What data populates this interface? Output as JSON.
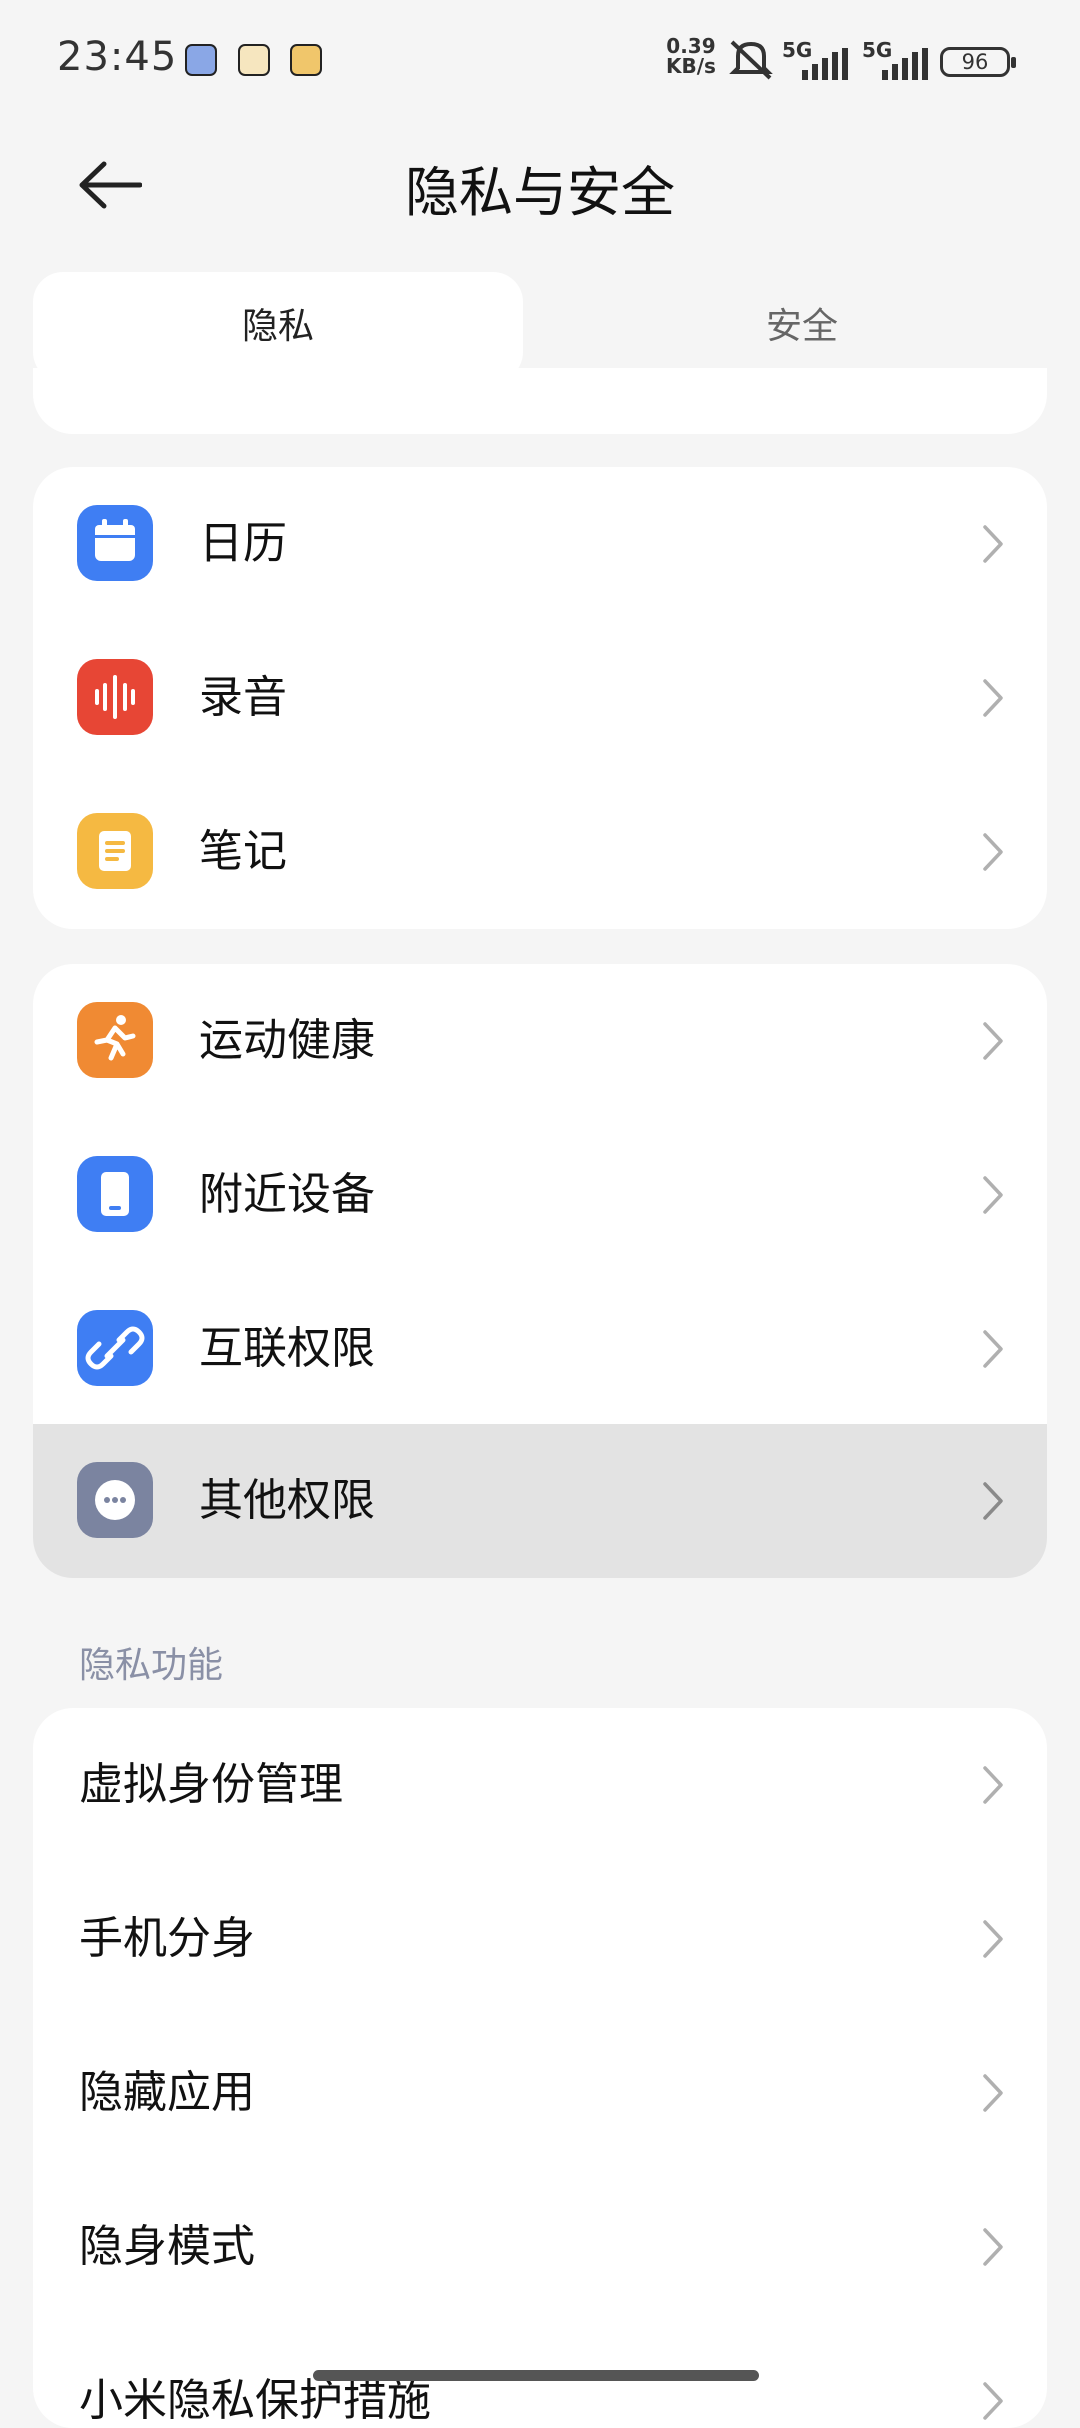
{
  "status_bar": {
    "time": "23:45",
    "speed_value": "0.39",
    "speed_unit": "KB/s",
    "net1": "5G",
    "net2": "5G",
    "battery": "96",
    "notification_icons": [
      "app-notif-icon-1",
      "app-notif-icon-2",
      "app-notif-icon-3"
    ]
  },
  "header": {
    "title": "隐私与安全",
    "back_icon": "back-arrow-icon"
  },
  "tabs": [
    {
      "label": "隐私",
      "active": true
    },
    {
      "label": "安全",
      "active": false
    }
  ],
  "group1": [
    {
      "label": "日历",
      "icon": "calendar-icon",
      "color": "#3f7ef3"
    },
    {
      "label": "录音",
      "icon": "recorder-icon",
      "color": "#e74635"
    },
    {
      "label": "笔记",
      "icon": "notes-icon",
      "color": "#f5b942"
    }
  ],
  "group2": [
    {
      "label": "运动健康",
      "icon": "running-icon",
      "color": "#f08a33"
    },
    {
      "label": "附近设备",
      "icon": "nearby-device-icon",
      "color": "#3f7ef3"
    },
    {
      "label": "互联权限",
      "icon": "link-icon",
      "color": "#3f7ef3"
    },
    {
      "label": "其他权限",
      "icon": "more-icon",
      "color": "#7b84a0",
      "selected": true
    }
  ],
  "section_title": "隐私功能",
  "group3": [
    {
      "label": "虚拟身份管理"
    },
    {
      "label": "手机分身"
    },
    {
      "label": "隐藏应用"
    },
    {
      "label": "隐身模式"
    },
    {
      "label": "小米隐私保护措施"
    }
  ]
}
